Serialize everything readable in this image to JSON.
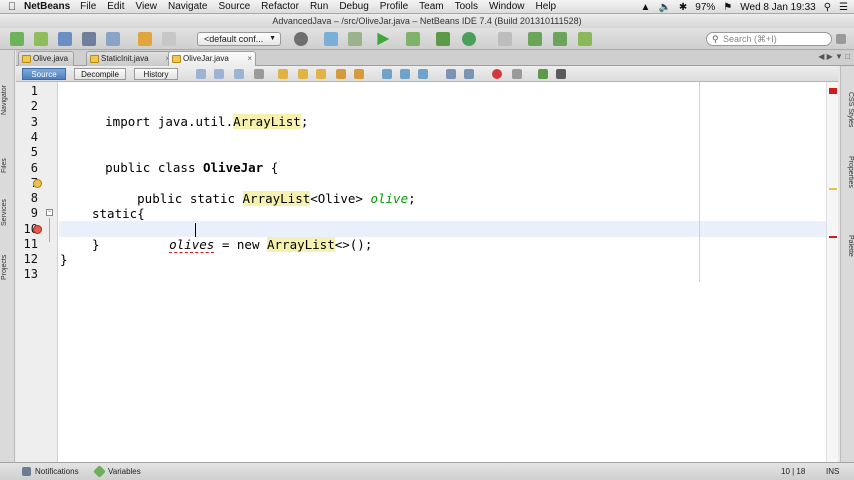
{
  "menubar": {
    "app_name": "NetBeans",
    "items": [
      "File",
      "Edit",
      "View",
      "Navigate",
      "Source",
      "Refactor",
      "Run",
      "Debug",
      "Profile",
      "Team",
      "Tools",
      "Window",
      "Help"
    ],
    "battery": "97%",
    "datetime": "Wed 8 Jan  19:33"
  },
  "window": {
    "title": "AdvancedJava – /src/OliveJar.java – NetBeans IDE 7.4 (Build 201310111528)"
  },
  "toolbar": {
    "config_select": "<default conf...",
    "search_placeholder": "Search (⌘+I)"
  },
  "side_panels": {
    "left": [
      "Navigator",
      "Files",
      "Services",
      "Projects"
    ],
    "right": [
      "CSS Styles",
      "Properties",
      "Palette"
    ]
  },
  "editor_tabs": [
    {
      "label": "Olive.java",
      "active": false
    },
    {
      "label": "StaticInit.java",
      "active": false
    },
    {
      "label": "OliveJar.java",
      "active": true
    }
  ],
  "editor_toolbar": {
    "source": "Source",
    "decompile": "Decompile",
    "history": "History"
  },
  "code": {
    "line_numbers": [
      "1",
      "2",
      "3",
      "4",
      "5",
      "6",
      "7",
      "8",
      "9",
      "10",
      "11",
      "12",
      "13"
    ],
    "l2": {
      "kw": "import java.util.",
      "cls": "ArrayList",
      "end": ";"
    },
    "l5": {
      "kw": "public class ",
      "name": "OliveJar",
      "end": " {"
    },
    "l7": {
      "kw": "public static ",
      "cls": "ArrayList",
      "generic": "<Olive> ",
      "field": "olive",
      "end": ";"
    },
    "l9": {
      "text": "static{"
    },
    "l10": {
      "err": "olives",
      "mid": " = ",
      "new": "new ",
      "cls": "ArrayList",
      "end": "<>();"
    },
    "l11": {
      "text": "}"
    },
    "l12": {
      "text": "}"
    }
  },
  "statusbar": {
    "notifications": "Notifications",
    "variables": "Variables",
    "position": "10 | 18",
    "mode": "INS"
  },
  "colors": {
    "highlight": "#f7f1b0",
    "field": "#009a00",
    "error": "#d21b1b",
    "current_line": "#e9effb"
  }
}
